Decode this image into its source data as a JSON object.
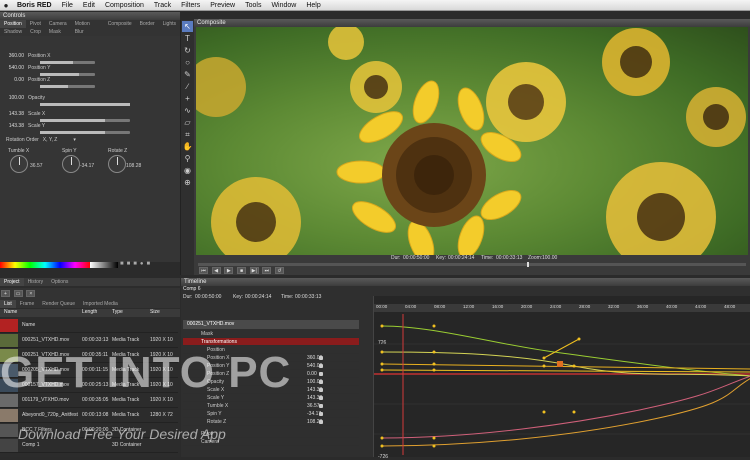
{
  "menubar": {
    "app": "Boris RED",
    "items": [
      "File",
      "Edit",
      "Composition",
      "Track",
      "Filters",
      "Preview",
      "Tools",
      "Window",
      "Help"
    ]
  },
  "controls": {
    "title": "Controls",
    "tabs": [
      "Position",
      "Pivot",
      "Camera",
      "Motion Blur",
      "Composite",
      "Border",
      "Lights"
    ],
    "tabs2": [
      "Shadow",
      "Crop",
      "Mask"
    ],
    "position": {
      "x_val": "360.00",
      "x_label": "Position X",
      "y_val": "540.00",
      "y_label": "Position Y",
      "z_val": "0.00",
      "z_label": "Position Z"
    },
    "opacity": {
      "val": "100.00",
      "label": "Opacity"
    },
    "scale": {
      "x_val": "143.38",
      "x_label": "Scale X",
      "y_val": "143.38",
      "y_label": "Scale Y"
    },
    "rotation_order_label": "Rotation Order",
    "rotation_order_value": "X, Y, Z",
    "tumble": {
      "label": "Tumble X",
      "val": "36.57"
    },
    "spin": {
      "label": "Spin Y",
      "val": "-34.17"
    },
    "rotate": {
      "label": "Rotate Z",
      "val": "108.28"
    }
  },
  "composite": {
    "title": "Composite",
    "dur_label": "Dur:",
    "dur": "00:00:50:00",
    "key_label": "Key:",
    "key": "00:00:24:14",
    "time_label": "Time:",
    "time": "00:00:33:13",
    "zoom_label": "Zoom:",
    "zoom": "100.00"
  },
  "project": {
    "tabs": [
      "Project",
      "History",
      "Options"
    ],
    "subtabs": [
      "List",
      "Frame",
      "Render Queue",
      "Imported Media"
    ],
    "columns": [
      "Name",
      "Length",
      "Type",
      "Size"
    ],
    "rows": [
      {
        "name": "Name",
        "length": "",
        "type": "",
        "size": ""
      },
      {
        "name": "000251_VTXHD.mov",
        "length": "00:00:33:13",
        "type": "Media Track",
        "size": "1920 X 10"
      },
      {
        "name": "000251_VTXHD.mov",
        "length": "00:00:35:11",
        "type": "Media Track",
        "size": "1920 X 10"
      },
      {
        "name": "000205_VTXHD.mov",
        "length": "00:00:11:15",
        "type": "Media Track",
        "size": "1920 X 10"
      },
      {
        "name": "000157_VTXHD.mov",
        "length": "00:00:25:13",
        "type": "Media Track",
        "size": "1920 X 10"
      },
      {
        "name": "001179_VTXHD.mov",
        "length": "00:00:35:05",
        "type": "Media Track",
        "size": "1920 X 10"
      },
      {
        "name": "Abeyond0_720p_Anitfest",
        "length": "00:00:13:08",
        "type": "Media Track",
        "size": "1280 X 72"
      },
      {
        "name": "BCC 7 Filters",
        "length": "00:00:20:00",
        "type": "3D Container",
        "size": ""
      },
      {
        "name": "Comp 1",
        "length": "",
        "type": "3D Container",
        "size": ""
      }
    ]
  },
  "timeline": {
    "title": "Timeline",
    "comp": "Comp 6",
    "dur_label": "Dur:",
    "dur": "00:00:50:00",
    "key_label": "Key:",
    "key": "00:00:24:14",
    "time_label": "Time:",
    "time": "00:00:33:13",
    "layer": "000251_VTXHD.mov",
    "tracks": [
      {
        "name": "Mask",
        "val": ""
      },
      {
        "name": "Transformations",
        "val": ""
      },
      {
        "name": "Position",
        "val": ""
      },
      {
        "name": "Position X",
        "val": "360.00"
      },
      {
        "name": "Position Y",
        "val": "540.00"
      },
      {
        "name": "Position Z",
        "val": "0.00"
      },
      {
        "name": "Opacity",
        "val": "100.00"
      },
      {
        "name": "Scale X",
        "val": "143.38"
      },
      {
        "name": "Scale Y",
        "val": "143.38"
      },
      {
        "name": "Tumble X",
        "val": "36.57"
      },
      {
        "name": "Spin Y",
        "val": "-34.17"
      },
      {
        "name": "Rotate Z",
        "val": "108.28"
      },
      {
        "name": "Pivot",
        "val": ""
      },
      {
        "name": "Camera",
        "val": ""
      }
    ],
    "ruler": [
      "00:00",
      "04:00",
      "08:00",
      "12:00",
      "16:00",
      "20:00",
      "24:00",
      "28:00",
      "32:00",
      "36:00",
      "40:00",
      "44:00",
      "48:00"
    ],
    "curve_labels": {
      "top": "726",
      "bottom": "-726"
    }
  },
  "watermark": {
    "main": "GET INTO PC",
    "sub": "Download Free Your Desired App"
  },
  "colors": {
    "accent": "#5a7bbf",
    "playhead": "#d23a3a",
    "curve_yellow": "#f0c020",
    "curve_green": "#7ab040",
    "curve_pink": "#d0607a"
  }
}
